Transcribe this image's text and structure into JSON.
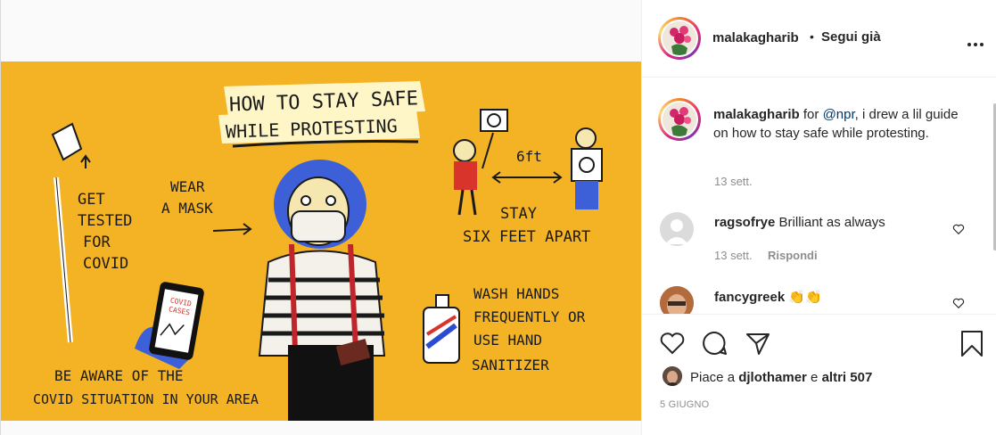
{
  "post_header": {
    "username": "malakagharib",
    "separator": "•",
    "follow_status": "Segui già",
    "more_icon": "more-horizontal-icon"
  },
  "caption": {
    "username": "malakagharib",
    "text_before_mention": " for ",
    "mention": "@npr",
    "text_after_mention": ", i drew a lil guide on how to stay safe while protesting.",
    "time": "13 sett."
  },
  "comments": [
    {
      "username": "ragsofrye",
      "text": " Brilliant as always",
      "time": "13 sett.",
      "reply_label": "Rispondi"
    },
    {
      "username": "fancygreek",
      "text": " 👏👏"
    }
  ],
  "actions": {
    "icons": [
      "heart-icon",
      "comment-icon",
      "share-icon",
      "bookmark-icon"
    ]
  },
  "likes": {
    "prefix": "Piace a ",
    "user": "djlothamer",
    "conjunction": " e ",
    "others": "altri 507"
  },
  "post_date": "5 GIUGNO",
  "artwork": {
    "title_line1": "HOW TO STAY SAFE",
    "title_line2": "WHILE PROTESTING",
    "tested_text": [
      "GET",
      "TESTED",
      "FOR",
      "COVID"
    ],
    "mask_text": [
      "WEAR",
      "A MASK"
    ],
    "distance_label": "6ft",
    "stay_text": [
      "STAY",
      "SIX FEET APART"
    ],
    "wash_text": [
      "WASH HANDS",
      "FREQUENTLY OR",
      "USE HAND",
      "SANITIZER"
    ],
    "aware_text": [
      "BE AWARE OF THE",
      "COVID SITUATION IN YOUR AREA"
    ],
    "phone_text": [
      "COVID",
      "CASES"
    ]
  },
  "colors": {
    "art_background": "#f4b324",
    "link": "#00376b",
    "text": "#262626",
    "muted": "#8e8e8e"
  }
}
